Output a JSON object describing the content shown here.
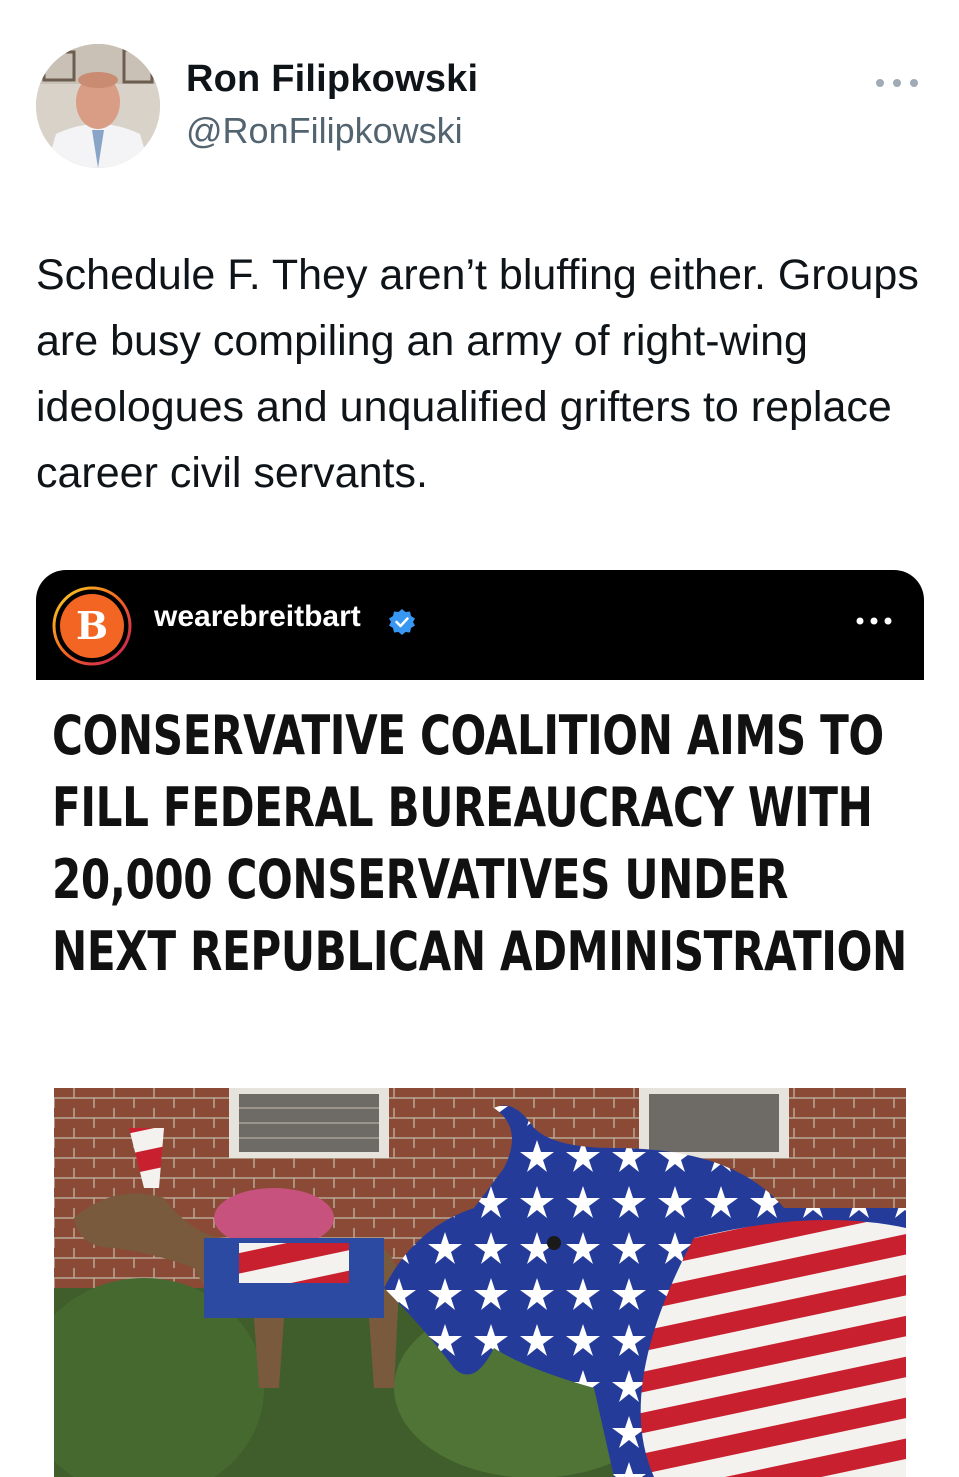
{
  "author": {
    "name": "Ron Filipkowski",
    "handle": "@RonFilipkowski"
  },
  "tweet": {
    "text": "Schedule F. They aren’t bluffing either. Groups are busy compiling an army of right-wing ideologues and unqualified grifters to replace career civil servants."
  },
  "embedded_post": {
    "account_name": "wearebreitbart",
    "logo_letter": "B",
    "headline": "CONSERVATIVE COALITION AIMS TO FILL FEDERAL BUREAUCRACY WITH 20,000 CONSERVATIVES UNDER NEXT REPUBLICAN ADMINISTRATION"
  },
  "icons": {
    "more": "more-horizontal-icon",
    "verified": "verified-badge-icon"
  },
  "colors": {
    "text_primary": "#0f1419",
    "text_secondary": "#536471",
    "verified_blue": "#3897f0",
    "breitbart_orange": "#f26522"
  }
}
